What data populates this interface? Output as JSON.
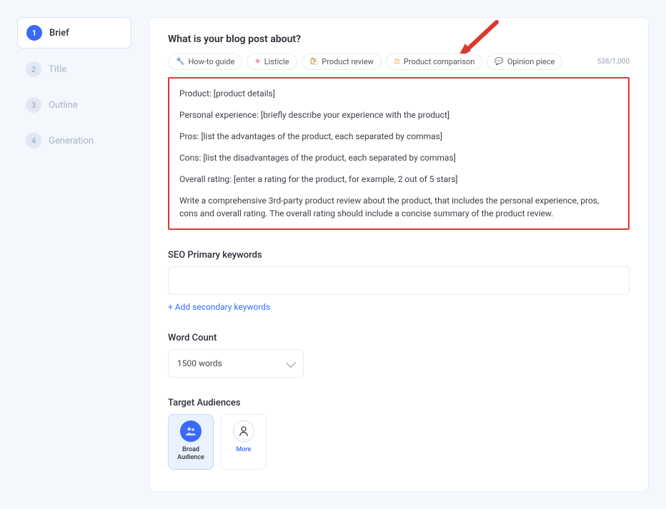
{
  "sidebar": {
    "steps": [
      {
        "num": "1",
        "label": "Brief",
        "active": true
      },
      {
        "num": "2",
        "label": "Title",
        "active": false
      },
      {
        "num": "3",
        "label": "Outline",
        "active": false
      },
      {
        "num": "4",
        "label": "Generation",
        "active": false
      }
    ]
  },
  "brief": {
    "heading": "What is your blog post about?",
    "chips": [
      {
        "icon": "🔧",
        "label": "How-to guide"
      },
      {
        "icon": "✳",
        "iconColor": "#e83e8c",
        "label": "Listicle"
      },
      {
        "icon": "🛍",
        "iconColor": "#c58a2e",
        "label": "Product review"
      },
      {
        "icon": "⚖",
        "iconColor": "#e6a63c",
        "label": "Product comparison"
      },
      {
        "icon": "💬",
        "iconColor": "#9aa3b5",
        "label": "Opinion piece"
      }
    ],
    "counter": "538/1,000",
    "body": {
      "l1": "Product: [product details]",
      "l2": "Personal experience: [briefly describe your experience with the product]",
      "l3": "Pros: [list the advantages of the product, each separated by commas]",
      "l4": "Cons: [list the disadvantages of the product, each separated by commas]",
      "l5": "Overall rating: [enter a rating for the product, for example, 2 out of 5 stars]",
      "l6": "Write a comprehensive 3rd-party product review about the product, that includes the personal experience, pros, cons and overall rating.  The overall rating should include a concise summary of the product review."
    }
  },
  "seo": {
    "label": "SEO Primary keywords",
    "value": "",
    "add_link": "+ Add secondary keywords"
  },
  "wordcount": {
    "label": "Word Count",
    "selected": "1500 words"
  },
  "audiences": {
    "label": "Target Audiences",
    "items": [
      {
        "key": "broad",
        "label": "Broad Audience",
        "selected": true
      },
      {
        "key": "more",
        "label": "More",
        "selected": false
      }
    ]
  }
}
